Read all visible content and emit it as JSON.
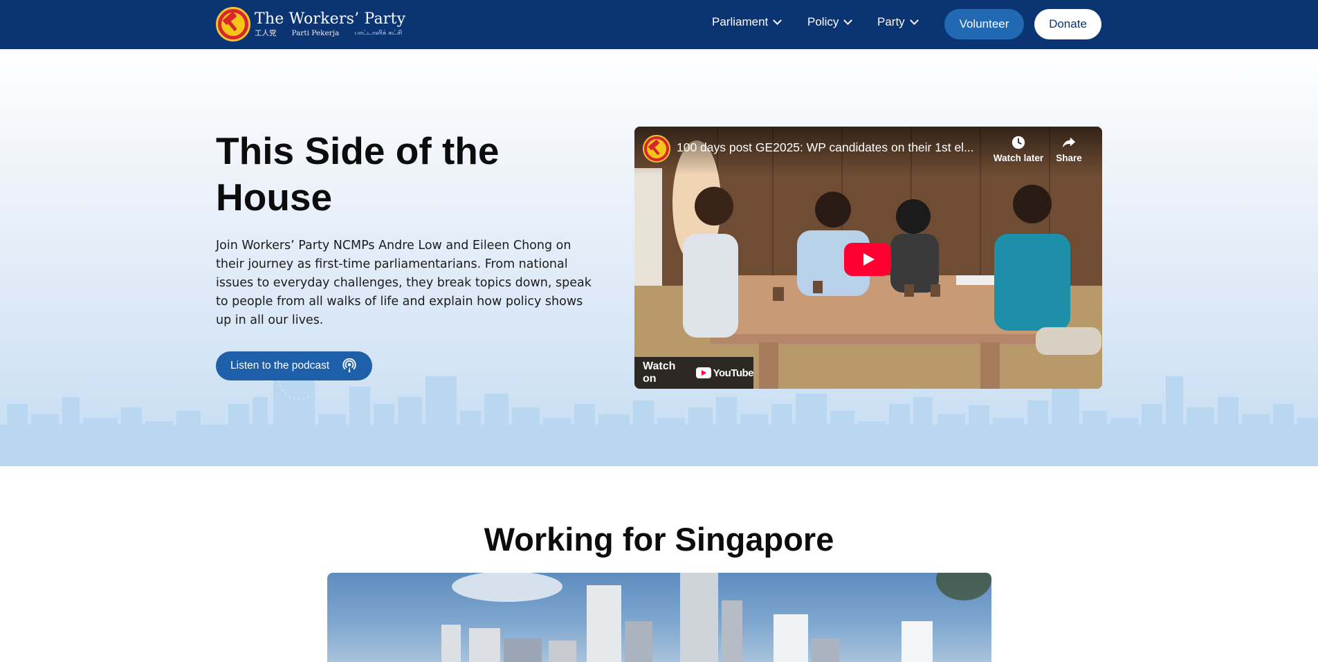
{
  "nav": {
    "logo": {
      "title": "The Workers’ Party",
      "sub_chinese": "工人党",
      "sub_malay": "Parti Pekerja",
      "sub_tamil": "பாட்டாளிக் கட்சி"
    },
    "items": [
      {
        "label": "Parliament"
      },
      {
        "label": "Policy"
      },
      {
        "label": "Party"
      }
    ],
    "volunteer_label": "Volunteer",
    "donate_label": "Donate"
  },
  "hero": {
    "title": "This Side of the House",
    "description": "Join Workers’ Party NCMPs Andre Low and Eileen Chong on their journey as first-time parliamentarians. From national issues to everyday challenges, they break topics down, speak to people from all walks of life and explain how policy shows up in all our lives.",
    "podcast_button": "Listen to the podcast"
  },
  "video": {
    "title": "100 days post GE2025: WP candidates on their 1st el...",
    "watch_later": "Watch later",
    "share": "Share",
    "watch_on": "Watch on",
    "youtube": "YouTube"
  },
  "section": {
    "title": "Working for Singapore"
  },
  "colors": {
    "nav_bg": "#0b3472",
    "accent_button": "#2169b3",
    "podcast_button": "#1d5fa8",
    "skyline": "#b9d7f0"
  }
}
